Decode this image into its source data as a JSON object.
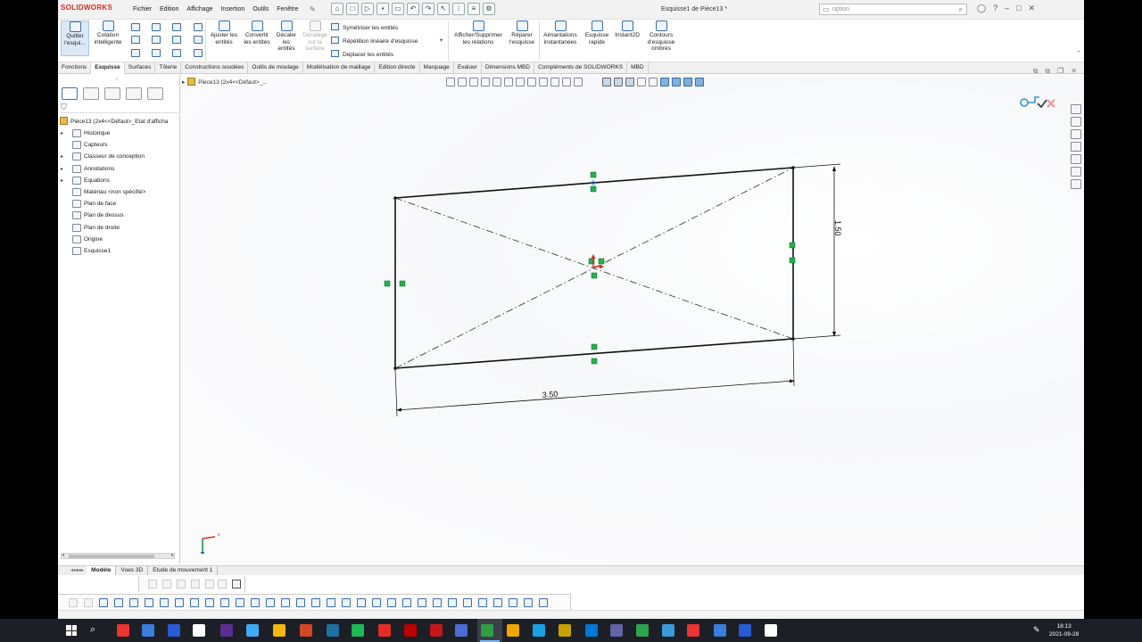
{
  "app": {
    "logo": "SOLIDWORKS",
    "menu": [
      "Fichier",
      "Edition",
      "Affichage",
      "Insertion",
      "Outils",
      "Fenêtre"
    ],
    "doc_title": "Esquisse1 de Pièce13 *",
    "search_placeholder": "option"
  },
  "commands": {
    "quit_sketch": "Quitter l'esqui...",
    "smart_dim": "Cotation intelligente",
    "trim": "Ajuster les entités",
    "convert": "Convertir les entités",
    "offset": "Décaler les entités",
    "offset_surface": "Décalage sur la surface",
    "mirror": "Symétriser les entités",
    "linear_pattern": "Répétition linéaire d'esquisse",
    "move": "Déplacer les entités",
    "relations": "Afficher/Supprimer les relations",
    "repair": "Réparer l'esquisse",
    "snaps": "Aimantations instantanées",
    "rapid": "Esquisse rapide",
    "instant2d": "Instant2D",
    "shaded": "Contours d'esquisse ombrés"
  },
  "tabs": [
    "Fonctions",
    "Esquisse",
    "Surfaces",
    "Tôlerie",
    "Constructions soudées",
    "Outils de moulage",
    "Modélisation de maillage",
    "Edition directe",
    "Marquage",
    "Evaluer",
    "Dimensions MBD",
    "Compléments de SOLIDWORKS",
    "MBD"
  ],
  "active_tab": "Esquisse",
  "feature_tree": {
    "root": "Pièce13  (2x4<<Défaut>_Etat d'afficha",
    "items": [
      {
        "label": "Historique",
        "expandable": true
      },
      {
        "label": "Capteurs",
        "expandable": false
      },
      {
        "label": "Classeur de conception",
        "expandable": true
      },
      {
        "label": "Annotations",
        "expandable": true
      },
      {
        "label": "Equations",
        "expandable": true
      },
      {
        "label": "Matériau <non spécifié>",
        "expandable": false
      },
      {
        "label": "Plan de face",
        "expandable": false
      },
      {
        "label": "Plan de dessus",
        "expandable": false
      },
      {
        "label": "Plan de droite",
        "expandable": false
      },
      {
        "label": "Origine",
        "expandable": false
      },
      {
        "label": "Esquisse1",
        "expandable": false
      }
    ]
  },
  "breadcrumb": "Pièce13  (2x4<<Défaut>_...",
  "sketch": {
    "dim_width": "3.50",
    "dim_height": "1.50"
  },
  "bottom_tabs": [
    "Modèle",
    "Vues 3D",
    "Etude de mouvement 1"
  ],
  "active_bottom_tab": "Modèle",
  "taskbar": {
    "time": "18:13",
    "date": "2021-09-28"
  },
  "colors": {
    "brand": "#d52b1e",
    "sketch_line": "#111111",
    "relation_green": "#22b24c",
    "taskbar": "#1c1f26"
  }
}
